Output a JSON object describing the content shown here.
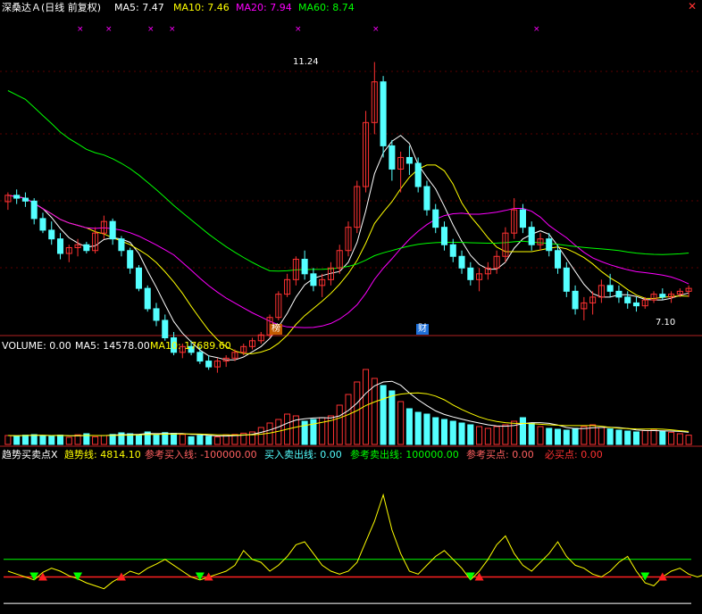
{
  "header": {
    "stock": "深桑达Ａ(日线 前复权)",
    "ma5": "MA5: 7.47",
    "ma10": "MA10: 7.46",
    "ma20": "MA20: 7.94",
    "ma60": "MA60: 8.74"
  },
  "volume_header": {
    "volume": "VOLUME: 0.00",
    "ma5": "MA5: 14578.00",
    "ma10": "MA10: 17689.60"
  },
  "indicator_header": {
    "name": "趋势买卖点X",
    "trend": "趋势线: 4814.10",
    "ref_buy_line": "参考买入线: -100000.00",
    "buy_sell_line": "买入卖出线: 0.00",
    "ref_sell_line": "参考卖出线: 100000.00",
    "ref_buy_point": "参考买点: 0.00",
    "must_buy_point": "必买点: 0.00"
  },
  "annotations": {
    "high": "11.24",
    "low": "7.10",
    "badge1": "榜",
    "badge2": "财"
  },
  "colors": {
    "up": "#ff3232",
    "down": "#54ffff",
    "ma5": "#ffffff",
    "ma10": "#ffff00",
    "ma20": "#ff00ff",
    "ma60": "#00ff00",
    "axis": "#b22222"
  },
  "chart_data": {
    "type": "candlestick",
    "price_range": [
      6.6,
      12.0
    ],
    "candles": [
      [
        8.84,
        9.0,
        8.7,
        8.95
      ],
      [
        8.95,
        9.05,
        8.8,
        8.9
      ],
      [
        8.9,
        9.0,
        8.75,
        8.85
      ],
      [
        8.85,
        8.9,
        8.45,
        8.55
      ],
      [
        8.55,
        8.65,
        8.3,
        8.35
      ],
      [
        8.35,
        8.5,
        8.1,
        8.2
      ],
      [
        8.2,
        8.3,
        7.85,
        7.95
      ],
      [
        7.95,
        8.1,
        7.8,
        8.05
      ],
      [
        8.05,
        8.2,
        7.9,
        8.1
      ],
      [
        8.1,
        8.15,
        7.95,
        8.0
      ],
      [
        8.0,
        8.4,
        7.95,
        8.3
      ],
      [
        8.3,
        8.6,
        8.2,
        8.5
      ],
      [
        8.5,
        8.55,
        8.1,
        8.2
      ],
      [
        8.2,
        8.25,
        7.9,
        8.0
      ],
      [
        8.0,
        8.05,
        7.6,
        7.7
      ],
      [
        7.7,
        7.75,
        7.3,
        7.35
      ],
      [
        7.35,
        7.4,
        6.95,
        7.0
      ],
      [
        7.0,
        7.1,
        6.7,
        6.8
      ],
      [
        6.8,
        6.9,
        6.45,
        6.5
      ],
      [
        6.5,
        6.6,
        6.2,
        6.25
      ],
      [
        6.25,
        6.4,
        6.15,
        6.35
      ],
      [
        6.35,
        6.45,
        6.2,
        6.25
      ],
      [
        6.25,
        6.35,
        6.05,
        6.1
      ],
      [
        6.1,
        6.2,
        5.95,
        6.0
      ],
      [
        6.0,
        6.15,
        5.9,
        6.1
      ],
      [
        6.1,
        6.2,
        6.0,
        6.15
      ],
      [
        6.15,
        6.3,
        6.1,
        6.25
      ],
      [
        6.25,
        6.4,
        6.2,
        6.35
      ],
      [
        6.35,
        6.5,
        6.3,
        6.45
      ],
      [
        6.45,
        6.6,
        6.4,
        6.55
      ],
      [
        6.55,
        6.9,
        6.5,
        6.85
      ],
      [
        6.85,
        7.3,
        6.8,
        7.25
      ],
      [
        7.25,
        7.6,
        7.2,
        7.5
      ],
      [
        7.5,
        7.9,
        7.4,
        7.85
      ],
      [
        7.85,
        8.0,
        7.5,
        7.6
      ],
      [
        7.6,
        7.7,
        7.3,
        7.4
      ],
      [
        7.4,
        7.6,
        7.2,
        7.5
      ],
      [
        7.5,
        7.8,
        7.4,
        7.7
      ],
      [
        7.7,
        8.1,
        7.6,
        8.0
      ],
      [
        8.0,
        8.5,
        7.9,
        8.4
      ],
      [
        8.4,
        9.2,
        8.3,
        9.1
      ],
      [
        9.1,
        10.4,
        9.0,
        10.2
      ],
      [
        10.2,
        11.24,
        10.0,
        10.9
      ],
      [
        10.9,
        11.0,
        9.6,
        9.8
      ],
      [
        9.8,
        9.9,
        9.2,
        9.4
      ],
      [
        9.4,
        9.7,
        9.0,
        9.6
      ],
      [
        9.6,
        9.8,
        9.3,
        9.5
      ],
      [
        9.5,
        9.6,
        9.0,
        9.1
      ],
      [
        9.1,
        9.2,
        8.6,
        8.7
      ],
      [
        8.7,
        8.8,
        8.3,
        8.4
      ],
      [
        8.4,
        8.5,
        8.0,
        8.1
      ],
      [
        8.1,
        8.2,
        7.8,
        7.9
      ],
      [
        7.9,
        8.0,
        7.6,
        7.7
      ],
      [
        7.7,
        7.8,
        7.4,
        7.5
      ],
      [
        7.5,
        7.7,
        7.3,
        7.6
      ],
      [
        7.6,
        7.8,
        7.5,
        7.7
      ],
      [
        7.7,
        8.0,
        7.6,
        7.9
      ],
      [
        7.9,
        8.4,
        7.8,
        8.3
      ],
      [
        8.3,
        8.9,
        8.2,
        8.7
      ],
      [
        8.7,
        8.8,
        8.3,
        8.4
      ],
      [
        8.4,
        8.5,
        8.0,
        8.1
      ],
      [
        8.1,
        8.3,
        8.0,
        8.2
      ],
      [
        8.2,
        8.3,
        7.9,
        8.0
      ],
      [
        8.0,
        8.1,
        7.6,
        7.7
      ],
      [
        7.7,
        7.8,
        7.2,
        7.3
      ],
      [
        7.3,
        7.4,
        6.9,
        7.0
      ],
      [
        7.0,
        7.2,
        6.8,
        7.1
      ],
      [
        7.1,
        7.3,
        6.9,
        7.2
      ],
      [
        7.2,
        7.5,
        7.1,
        7.4
      ],
      [
        7.4,
        7.6,
        7.2,
        7.3
      ],
      [
        7.3,
        7.4,
        7.1,
        7.2
      ],
      [
        7.2,
        7.3,
        7.0,
        7.1
      ],
      [
        7.1,
        7.2,
        6.95,
        7.05
      ],
      [
        7.05,
        7.2,
        7.0,
        7.15
      ],
      [
        7.15,
        7.3,
        7.1,
        7.25
      ],
      [
        7.25,
        7.35,
        7.15,
        7.2
      ],
      [
        7.2,
        7.3,
        7.1,
        7.25
      ],
      [
        7.25,
        7.35,
        7.2,
        7.3
      ],
      [
        7.3,
        7.4,
        7.2,
        7.35
      ]
    ],
    "volume_range": [
      0,
      50000
    ],
    "volumes": [
      5000,
      4800,
      5200,
      5500,
      5000,
      4500,
      5200,
      4000,
      5400,
      6000,
      4300,
      5000,
      5600,
      6500,
      6000,
      5500,
      7000,
      5200,
      6600,
      6200,
      5600,
      4300,
      5000,
      4600,
      4200,
      5400,
      5600,
      6300,
      7000,
      9500,
      12000,
      14000,
      17000,
      16000,
      13000,
      14000,
      15000,
      16000,
      22000,
      28000,
      35000,
      42000,
      37000,
      33000,
      30000,
      24000,
      20000,
      18000,
      17000,
      15000,
      14000,
      13000,
      12000,
      11000,
      10000,
      9000,
      10000,
      11000,
      13000,
      15000,
      12000,
      10000,
      9000,
      8500,
      8000,
      9000,
      10000,
      11000,
      9500,
      8700,
      8000,
      7500,
      7000,
      7800,
      8400,
      7500,
      6800,
      6000,
      5200
    ],
    "indicator_range": [
      -60,
      200
    ],
    "trend": [
      10,
      5,
      0,
      -5,
      8,
      15,
      10,
      2,
      -3,
      -10,
      -15,
      -20,
      -8,
      0,
      10,
      5,
      15,
      22,
      30,
      20,
      10,
      0,
      -5,
      0,
      5,
      10,
      20,
      45,
      30,
      25,
      10,
      20,
      35,
      55,
      60,
      40,
      20,
      10,
      5,
      10,
      25,
      60,
      95,
      140,
      80,
      40,
      10,
      5,
      20,
      35,
      45,
      30,
      15,
      -5,
      10,
      30,
      55,
      70,
      40,
      20,
      10,
      25,
      40,
      60,
      35,
      20,
      15,
      5,
      0,
      10,
      25,
      35,
      10,
      -10,
      -15,
      0,
      10,
      15,
      5,
      0,
      5
    ]
  }
}
